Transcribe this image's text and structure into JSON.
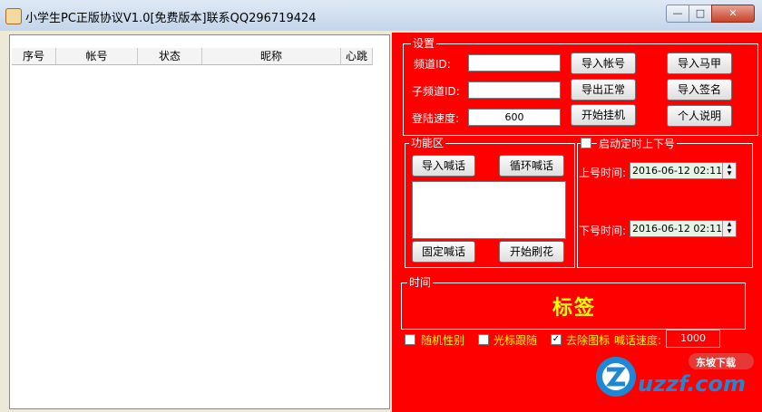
{
  "window": {
    "title": "小学生PC正版协议V1.0[免费版本]联系QQ296719424"
  },
  "list": {
    "columns": [
      "序号",
      "帐号",
      "状态",
      "昵称",
      "心跳"
    ]
  },
  "settings": {
    "group_label": "设置",
    "channel_id_label": "频道ID:",
    "channel_id_value": "",
    "sub_channel_label": "子频道ID:",
    "sub_channel_value": "",
    "login_speed_label": "登陆速度:",
    "login_speed_value": "600",
    "btn_import_account": "导入帐号",
    "btn_export_normal": "导出正常",
    "btn_start_hang": "开始挂机",
    "btn_import_vest": "导入马甲",
    "btn_import_sign": "导入签名",
    "btn_personal_note": "个人说明"
  },
  "function_area": {
    "group_label": "功能区",
    "btn_import_shout": "导入喊话",
    "btn_loop_shout": "循环喊话",
    "memo_text": "",
    "btn_fixed_shout": "固定喊话",
    "btn_start_flower": "开始刷花"
  },
  "timer": {
    "label": "启动定时上下号",
    "checked": false,
    "up_label": "上号时间:",
    "up_value": "2016-06-12  02:11",
    "down_label": "下号时间:",
    "down_value": "2016-06-12  02:11"
  },
  "time_group": {
    "label": "时间",
    "value": "标签"
  },
  "options": {
    "random_gender": "随机性别",
    "random_gender_checked": false,
    "cursor_follow": "光标跟随",
    "cursor_follow_checked": false,
    "remove_icon": "去除图标",
    "remove_icon_checked": true,
    "shout_speed_label": "喊话速度:",
    "shout_speed_value": "1000"
  },
  "watermark": {
    "text": "uzzf.com",
    "badge": "东坡下载"
  },
  "colors": {
    "panel": "#fe0000",
    "label_yellow": "#ffff00"
  }
}
